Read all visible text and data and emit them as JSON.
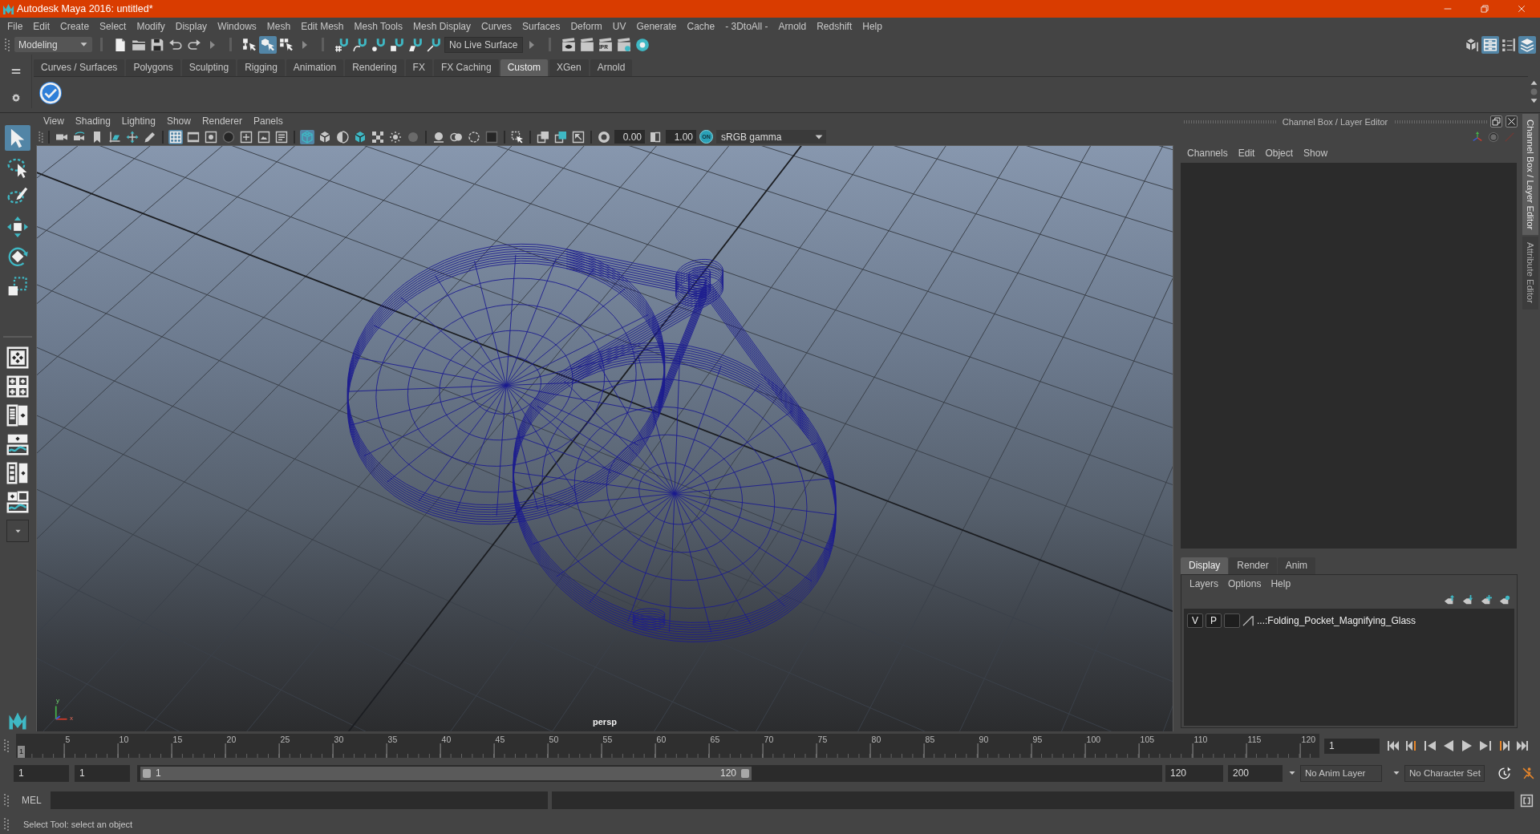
{
  "window": {
    "title": "Autodesk Maya 2016: untitled*"
  },
  "menu_bar": [
    "File",
    "Edit",
    "Create",
    "Select",
    "Modify",
    "Display",
    "Windows",
    "Mesh",
    "Edit Mesh",
    "Mesh Tools",
    "Mesh Display",
    "Curves",
    "Surfaces",
    "Deform",
    "UV",
    "Generate",
    "Cache",
    "- 3DtoAll -",
    "Arnold",
    "Redshift",
    "Help"
  ],
  "status_line": {
    "menu_set": "Modeling",
    "selection_modes": [
      {
        "selected": false
      },
      {
        "selected": true
      },
      {
        "selected": false
      }
    ],
    "live_surface": "No Live Surface",
    "ipr_label": "IPR",
    "panel_toggles": [
      {
        "on": false
      },
      {
        "on": true
      },
      {
        "on": false
      },
      {
        "on": true
      }
    ]
  },
  "shelf": {
    "tabs": [
      {
        "label": "Curves / Surfaces",
        "selected": false
      },
      {
        "label": "Polygons",
        "selected": false
      },
      {
        "label": "Sculpting",
        "selected": false
      },
      {
        "label": "Rigging",
        "selected": false
      },
      {
        "label": "Animation",
        "selected": false
      },
      {
        "label": "Rendering",
        "selected": false
      },
      {
        "label": "FX",
        "selected": false
      },
      {
        "label": "FX Caching",
        "selected": false
      },
      {
        "label": "Custom",
        "selected": true
      },
      {
        "label": "XGen",
        "selected": false
      },
      {
        "label": "Arnold",
        "selected": false
      }
    ]
  },
  "toolbox": {
    "tools": [
      {
        "selected": true
      },
      {
        "selected": false
      },
      {
        "selected": false
      },
      {
        "selected": false
      },
      {
        "selected": false
      },
      {
        "selected": false
      }
    ]
  },
  "viewport": {
    "menus": [
      "View",
      "Shading",
      "Lighting",
      "Show",
      "Renderer",
      "Panels"
    ],
    "toolbar_buttons": [
      {
        "on": false
      },
      {
        "on": false
      },
      {
        "on": false
      },
      {
        "on": false
      },
      {
        "on": false
      },
      {
        "on": false
      },
      {
        "on": true
      },
      {
        "on": false
      },
      {
        "on": false
      },
      {
        "on": false
      },
      {
        "on": false
      },
      {
        "on": false
      },
      {
        "on": false
      },
      {
        "on": true
      },
      {
        "on": false
      },
      {
        "on": false
      },
      {
        "on": false
      },
      {
        "on": false
      },
      {
        "on": false
      },
      {
        "on": false
      },
      {
        "on": false
      },
      {
        "on": false
      },
      {
        "on": false
      },
      {
        "on": false
      },
      {
        "on": false
      },
      {
        "on": false
      },
      {
        "on": false
      },
      {
        "on": false
      }
    ],
    "exposure": "0.00",
    "gamma": "1.00",
    "color_management": "ON",
    "color_space": "sRGB gamma",
    "axis_labels": [
      "y",
      "x"
    ],
    "camera": "persp"
  },
  "channel_box": {
    "title": "Channel Box / Layer Editor",
    "menus": [
      "Channels",
      "Edit",
      "Object",
      "Show"
    ]
  },
  "layer_editor": {
    "tabs": [
      {
        "label": "Display",
        "selected": true
      },
      {
        "label": "Render",
        "selected": false
      },
      {
        "label": "Anim",
        "selected": false
      }
    ],
    "menus": [
      "Layers",
      "Options",
      "Help"
    ],
    "layers": [
      {
        "visibility": "V",
        "playback": "P",
        "name": "...:Folding_Pocket_Magnifying_Glass"
      }
    ]
  },
  "side_tabs": [
    {
      "label": "Channel Box / Layer Editor",
      "selected": true
    },
    {
      "label": "Attribute Editor",
      "selected": false
    }
  ],
  "time_slider": {
    "labels": [
      "5",
      "10",
      "15",
      "20",
      "25",
      "30",
      "35",
      "40",
      "45",
      "50",
      "55",
      "60",
      "65",
      "70",
      "75",
      "80",
      "85",
      "90",
      "95",
      "100",
      "105",
      "110",
      "115",
      "120"
    ],
    "current_frame": "1",
    "level": 0,
    "frame_field": "1"
  },
  "range_slider": {
    "start_field": "1",
    "range_start_field": "1",
    "range_start": "1",
    "range_end": "120",
    "level": 0.6,
    "range_end_field": "120",
    "end_field": "200"
  },
  "anim_layer": "No Anim Layer",
  "character_set": "No Character Set",
  "command_line": {
    "language": "MEL"
  },
  "help_line": "Select Tool: select an object"
}
